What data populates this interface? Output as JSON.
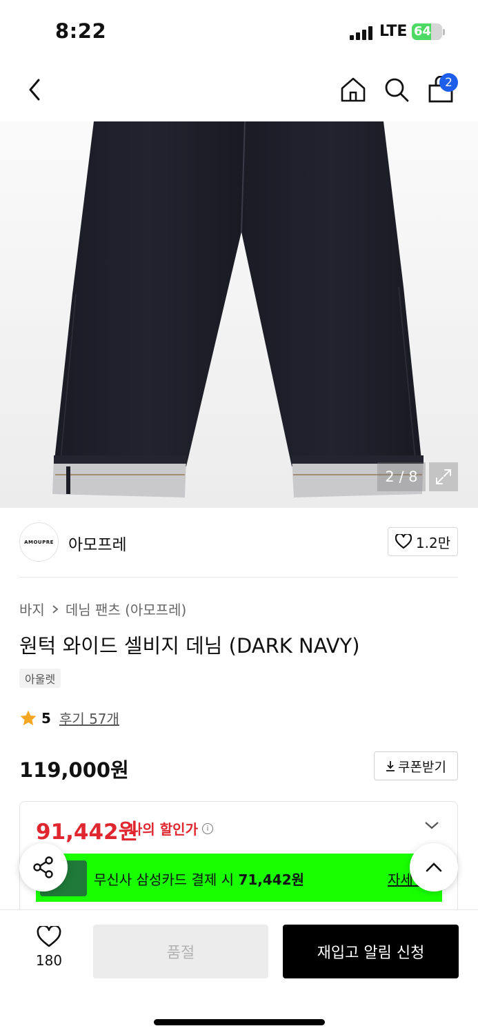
{
  "status_bar": {
    "time": "8:22",
    "network": "LTE",
    "battery": "64",
    "battery_level": 0.64
  },
  "nav": {
    "cart_count": "2"
  },
  "gallery": {
    "counter": "2 / 8"
  },
  "brand": {
    "logo_text": "AMOUPRE",
    "name": "아모프레",
    "likes": "1.2만"
  },
  "breadcrumb": {
    "level1": "바지",
    "level2": "데님 팬츠 (아모프레)"
  },
  "product": {
    "title": "원턱 와이드 셀비지 데님 (DARK NAVY)",
    "tag": "아울렛",
    "rating": "5",
    "reviews": "후기 57개",
    "price": "119,000원",
    "coupon_label": "쿠폰받기"
  },
  "discount": {
    "price": "91,442원",
    "label": "나의 할인가",
    "info": "i",
    "promo_text_prefix": "무신사 삼성카드 결제 시 ",
    "promo_amount": "71,442원",
    "promo_more": "자세히"
  },
  "bottom": {
    "wish_count": "180",
    "soldout_label": "품절",
    "restock_label": "재입고 알림 신청"
  },
  "colors": {
    "discount_red": "#e0262f",
    "promo_green": "#19ff00",
    "badge_blue": "#1d5eea"
  }
}
